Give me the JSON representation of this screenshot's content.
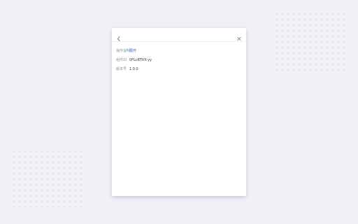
{
  "dialog": {
    "header": {
      "back_icon": "chevron-left-icon",
      "close_icon": "close-icon"
    },
    "rows": [
      {
        "label": "操作说明",
        "value": "展开",
        "kind": "link"
      },
      {
        "label": "组件ID",
        "value": "0FLcRTVX-yy",
        "kind": "text"
      },
      {
        "label": "版本号",
        "value": "1.0.0",
        "kind": "text"
      }
    ]
  },
  "colors": {
    "background": "#eff1f6",
    "link": "#3b63e8",
    "label": "#8c8f98",
    "value": "#33363d"
  }
}
